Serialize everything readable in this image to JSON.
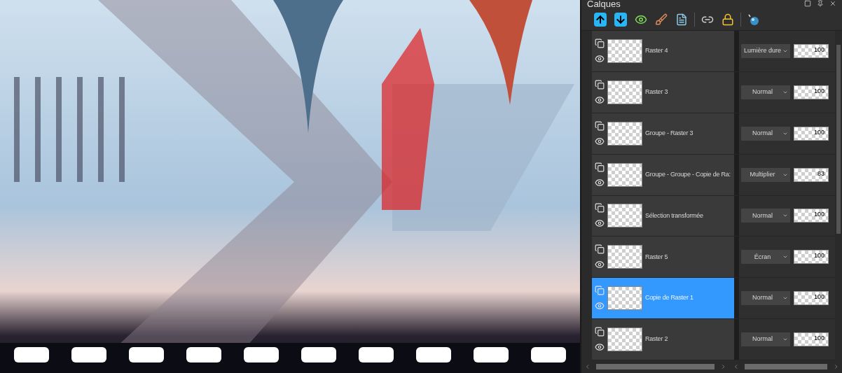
{
  "panel": {
    "title": "Calques"
  },
  "layers": [
    {
      "name": "Raster 4",
      "blend_mode": "Lumière dure",
      "opacity": "100",
      "selected": false
    },
    {
      "name": "Raster 3",
      "blend_mode": "Normal",
      "opacity": "100",
      "selected": false
    },
    {
      "name": "Groupe - Raster 3",
      "blend_mode": "Normal",
      "opacity": "100",
      "selected": false
    },
    {
      "name": "Groupe - Groupe - Copie de Ra:",
      "blend_mode": "Multiplier",
      "opacity": "83",
      "selected": false
    },
    {
      "name": "Sélection transformée",
      "blend_mode": "Normal",
      "opacity": "100",
      "selected": false
    },
    {
      "name": "Raster 5",
      "blend_mode": "Écran",
      "opacity": "100",
      "selected": false
    },
    {
      "name": "Copie de Raster 1",
      "blend_mode": "Normal",
      "opacity": "100",
      "selected": true
    },
    {
      "name": "Raster 2",
      "blend_mode": "Normal",
      "opacity": "100",
      "selected": false
    }
  ]
}
